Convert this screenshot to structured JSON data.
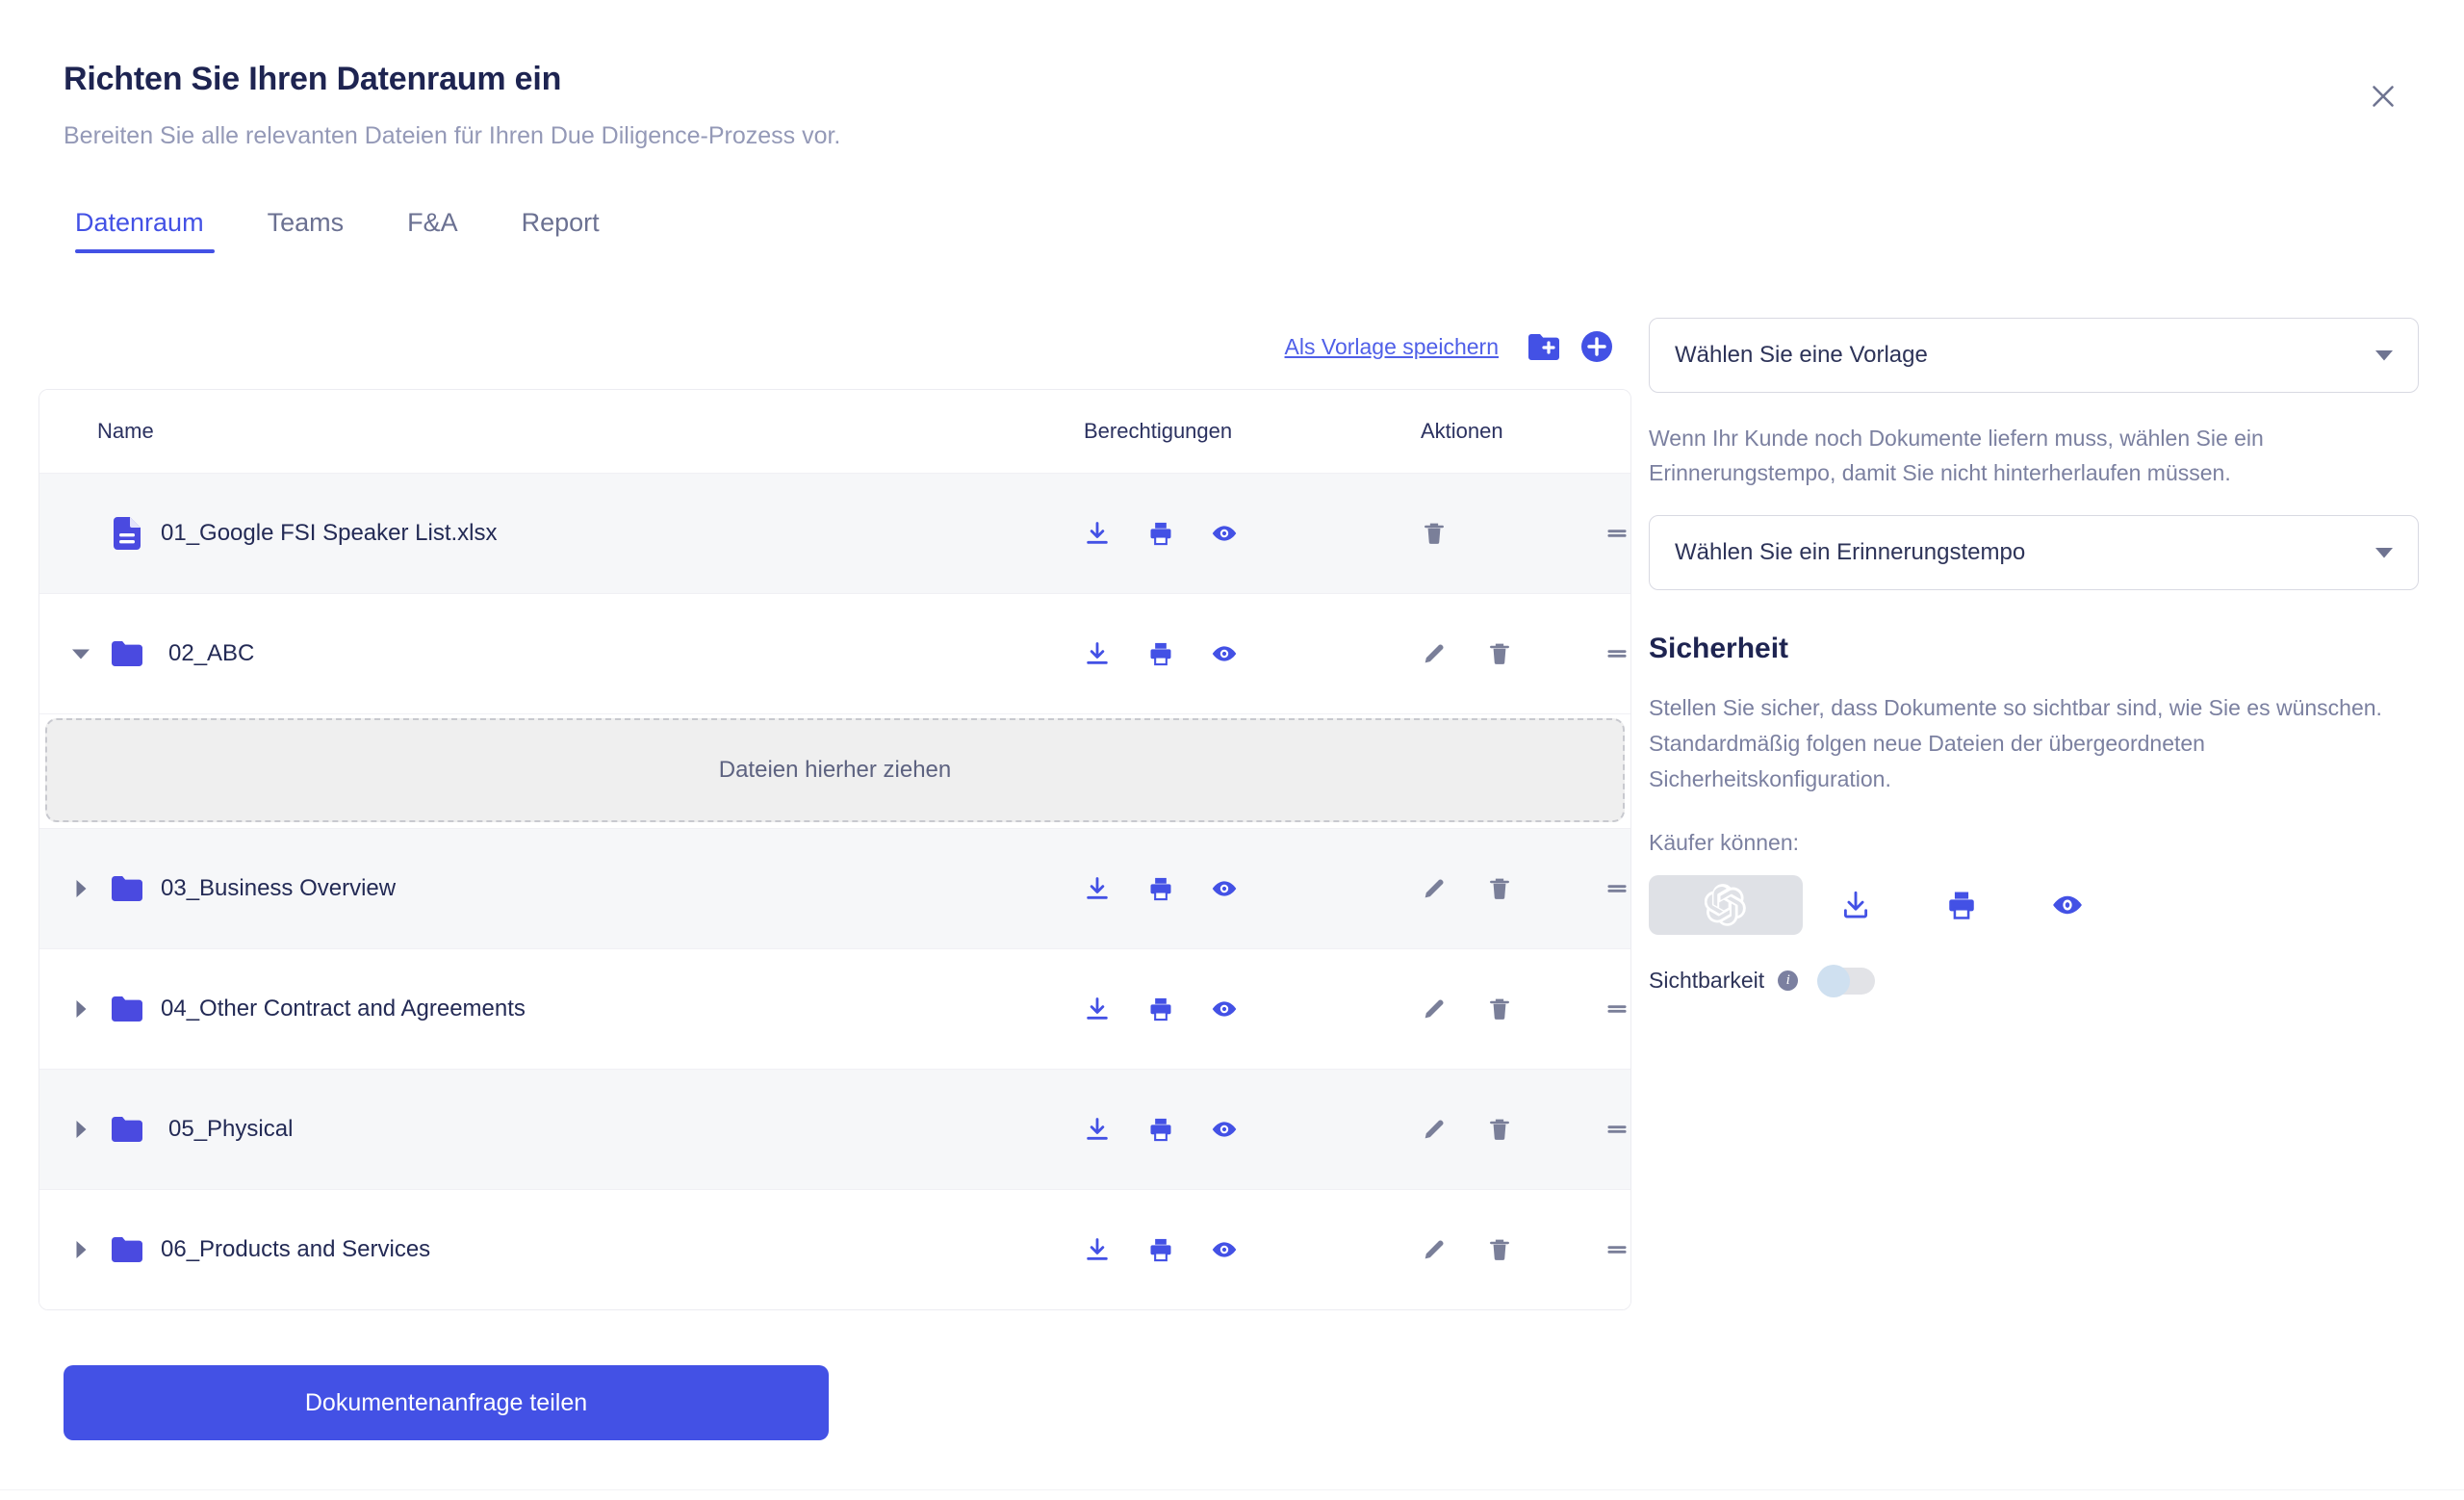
{
  "header": {
    "title": "Richten Sie Ihren Datenraum ein",
    "subtitle": "Bereiten Sie alle relevanten Dateien für Ihren Due Diligence-Prozess vor.",
    "close_label": "×"
  },
  "tabs": [
    {
      "label": "Datenraum",
      "active": true
    },
    {
      "label": "Teams",
      "active": false
    },
    {
      "label": "F&A",
      "active": false
    },
    {
      "label": "Report",
      "active": false
    }
  ],
  "toolbar": {
    "save_template_label": "Als Vorlage speichern",
    "new_folder_icon": "folder-plus-icon",
    "add_icon": "plus-circle-icon"
  },
  "table": {
    "columns": {
      "name": "Name",
      "permissions": "Berechtigungen",
      "actions": "Aktionen"
    },
    "rows": [
      {
        "type": "file",
        "label": "01_Google FSI Speaker List.xlsx",
        "icon": "file-icon",
        "twisty": "none",
        "striped": true,
        "has_edit": false
      },
      {
        "type": "folder",
        "label": "02_ABC",
        "icon": "folder-icon",
        "twisty": "expanded",
        "striped": false,
        "has_edit": true
      },
      {
        "type": "dropzone",
        "label": "Dateien hierher ziehen"
      },
      {
        "type": "folder",
        "label": "03_Business Overview",
        "icon": "folder-icon",
        "twisty": "collapsed",
        "striped": true,
        "has_edit": true
      },
      {
        "type": "folder",
        "label": "04_Other Contract and Agreements",
        "icon": "folder-icon",
        "twisty": "collapsed",
        "striped": false,
        "has_edit": true
      },
      {
        "type": "folder",
        "label": "05_Physical",
        "icon": "folder-icon",
        "twisty": "collapsed",
        "striped": true,
        "has_edit": true
      },
      {
        "type": "folder",
        "label": "06_Products and Services",
        "icon": "folder-icon",
        "twisty": "collapsed",
        "striped": false,
        "has_edit": true
      }
    ]
  },
  "primary_button": {
    "label": "Dokumentenanfrage teilen"
  },
  "sidebar": {
    "template_select": "Wählen Sie eine Vorlage",
    "reminder_helper": "Wenn Ihr Kunde noch Dokumente liefern muss, wählen Sie ein Erinnerungstempo, damit Sie nicht hinterherlaufen müssen.",
    "reminder_select": "Wählen Sie ein Erinnerungstempo",
    "security_title": "Sicherheit",
    "security_body": "Stellen Sie sicher, dass Dokumente so sichtbar sind, wie Sie es wünschen. Standardmäßig folgen neue Dateien der übergeordneten Sicherheitskonfiguration.",
    "buyers_label": "Käufer können:",
    "visibility_label": "Sichtbarkeit",
    "visibility_info": "i",
    "visibility_on": false
  },
  "colors": {
    "accent": "#4351e5",
    "accent_icon": "#4a4ae0",
    "title": "#1e2451",
    "muted": "#7b80a0",
    "row_stripe": "#f6f7f9",
    "dropzone_bg": "#efefef"
  }
}
